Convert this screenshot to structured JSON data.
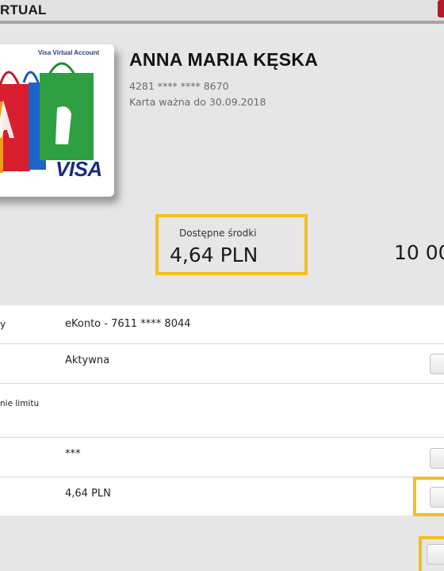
{
  "header": {
    "title": "RTUAL"
  },
  "card": {
    "brand_text": "Visa Virtual Account",
    "network": "VISA",
    "owner": "ANNA MARIA KĘSKA",
    "number": "4281 **** **** 8670",
    "valid_until": "Karta ważna do 30.09.2018"
  },
  "balance": {
    "label": "Dostępne środki",
    "value": "4,64 PLN",
    "limit_partial": "10 00"
  },
  "rows": [
    {
      "label": "y",
      "value": "eKonto - 7611 **** 8044"
    },
    {
      "label": "",
      "value": "Aktywna"
    },
    {
      "label": "nie limitu",
      "value": ""
    },
    {
      "label": "",
      "value": "***"
    },
    {
      "label": "",
      "value": "4,64 PLN"
    }
  ],
  "colors": {
    "highlight": "#f2c01f",
    "background": "#e6e6e6",
    "header_accent": "#b21c2a"
  }
}
